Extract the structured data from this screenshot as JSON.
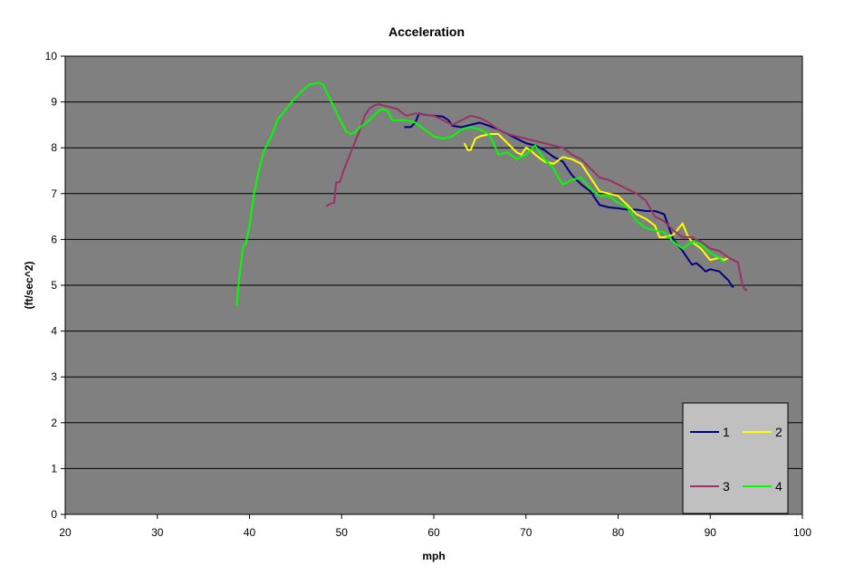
{
  "chart_data": {
    "type": "line",
    "title": "Acceleration",
    "xlabel": "mph",
    "ylabel": "(ft/sec^2)",
    "xlim": [
      20,
      100
    ],
    "ylim": [
      0,
      10
    ],
    "x_ticks": [
      "20",
      "30",
      "40",
      "50",
      "60",
      "70",
      "80",
      "90",
      "100"
    ],
    "y_ticks": [
      "0",
      "1",
      "2",
      "3",
      "4",
      "5",
      "6",
      "7",
      "8",
      "9",
      "10"
    ],
    "grid": "horizontal",
    "legend_position": "bottom-right",
    "plot_background": "#808080",
    "legend_background": "#c0c0c0",
    "series": [
      {
        "name": "1",
        "color": "#000080",
        "points": [
          [
            56.8,
            8.45
          ],
          [
            57.5,
            8.45
          ],
          [
            58.0,
            8.55
          ],
          [
            58.4,
            8.75
          ],
          [
            59,
            8.72
          ],
          [
            60,
            8.7
          ],
          [
            61,
            8.68
          ],
          [
            61.6,
            8.6
          ],
          [
            62,
            8.48
          ],
          [
            63,
            8.45
          ],
          [
            64,
            8.5
          ],
          [
            65,
            8.55
          ],
          [
            66,
            8.48
          ],
          [
            67,
            8.4
          ],
          [
            68,
            8.3
          ],
          [
            69,
            8.2
          ],
          [
            70,
            8.1
          ],
          [
            71,
            8.05
          ],
          [
            72,
            7.95
          ],
          [
            73,
            7.8
          ],
          [
            74,
            7.7
          ],
          [
            75,
            7.4
          ],
          [
            76,
            7.2
          ],
          [
            77,
            7.05
          ],
          [
            78,
            6.75
          ],
          [
            79,
            6.7
          ],
          [
            80,
            6.68
          ],
          [
            81,
            6.65
          ],
          [
            82,
            6.65
          ],
          [
            83,
            6.62
          ],
          [
            84,
            6.62
          ],
          [
            85,
            6.55
          ],
          [
            86,
            6.0
          ],
          [
            87,
            5.75
          ],
          [
            87.5,
            5.6
          ],
          [
            88,
            5.45
          ],
          [
            88.5,
            5.48
          ],
          [
            89,
            5.4
          ],
          [
            89.5,
            5.3
          ],
          [
            90,
            5.35
          ],
          [
            91,
            5.3
          ],
          [
            91.5,
            5.2
          ],
          [
            92,
            5.1
          ],
          [
            92.3,
            5.0
          ],
          [
            92.5,
            4.95
          ]
        ]
      },
      {
        "name": "2",
        "color": "#ffff00",
        "points": [
          [
            63.3,
            8.1
          ],
          [
            63.7,
            7.95
          ],
          [
            64,
            7.95
          ],
          [
            64.5,
            8.2
          ],
          [
            65,
            8.25
          ],
          [
            66,
            8.3
          ],
          [
            67,
            8.3
          ],
          [
            67.5,
            8.2
          ],
          [
            68,
            8.1
          ],
          [
            69,
            7.9
          ],
          [
            69.5,
            7.85
          ],
          [
            70,
            8.0
          ],
          [
            70.5,
            7.95
          ],
          [
            71,
            7.85
          ],
          [
            72,
            7.7
          ],
          [
            73,
            7.65
          ],
          [
            74,
            7.8
          ],
          [
            75,
            7.75
          ],
          [
            76,
            7.65
          ],
          [
            77,
            7.35
          ],
          [
            78,
            7.05
          ],
          [
            79,
            7.0
          ],
          [
            80,
            6.95
          ],
          [
            81,
            6.75
          ],
          [
            82,
            6.55
          ],
          [
            83,
            6.45
          ],
          [
            84,
            6.3
          ],
          [
            84.5,
            6.05
          ],
          [
            85,
            6.05
          ],
          [
            86,
            6.1
          ],
          [
            87,
            6.35
          ],
          [
            87.5,
            6.1
          ],
          [
            88,
            5.95
          ],
          [
            89,
            5.8
          ],
          [
            90,
            5.55
          ],
          [
            91,
            5.6
          ],
          [
            91.5,
            5.55
          ],
          [
            92,
            5.6
          ]
        ]
      },
      {
        "name": "3",
        "color": "#993366",
        "points": [
          [
            48.3,
            6.72
          ],
          [
            48.8,
            6.78
          ],
          [
            49.2,
            6.8
          ],
          [
            49.4,
            7.25
          ],
          [
            49.8,
            7.25
          ],
          [
            50.2,
            7.5
          ],
          [
            51,
            7.9
          ],
          [
            52,
            8.4
          ],
          [
            52.5,
            8.7
          ],
          [
            53,
            8.85
          ],
          [
            53.5,
            8.92
          ],
          [
            54,
            8.95
          ],
          [
            55,
            8.9
          ],
          [
            56,
            8.85
          ],
          [
            57,
            8.7
          ],
          [
            58,
            8.75
          ],
          [
            59,
            8.72
          ],
          [
            60,
            8.7
          ],
          [
            61,
            8.6
          ],
          [
            62,
            8.5
          ],
          [
            63,
            8.6
          ],
          [
            64,
            8.7
          ],
          [
            65,
            8.65
          ],
          [
            66,
            8.55
          ],
          [
            67,
            8.4
          ],
          [
            68,
            8.3
          ],
          [
            69,
            8.25
          ],
          [
            70,
            8.2
          ],
          [
            71,
            8.15
          ],
          [
            72,
            8.1
          ],
          [
            73,
            8.05
          ],
          [
            74,
            8.0
          ],
          [
            75,
            7.85
          ],
          [
            76,
            7.75
          ],
          [
            77,
            7.55
          ],
          [
            78,
            7.35
          ],
          [
            79,
            7.3
          ],
          [
            80,
            7.2
          ],
          [
            81,
            7.1
          ],
          [
            82,
            7.0
          ],
          [
            83,
            6.85
          ],
          [
            84,
            6.5
          ],
          [
            85,
            6.4
          ],
          [
            86,
            6.2
          ],
          [
            87,
            6.05
          ],
          [
            88,
            6.05
          ],
          [
            89,
            5.95
          ],
          [
            90,
            5.8
          ],
          [
            91,
            5.75
          ],
          [
            92,
            5.6
          ],
          [
            93,
            5.5
          ],
          [
            93.5,
            5.0
          ],
          [
            93.8,
            4.9
          ],
          [
            94,
            4.9
          ]
        ]
      },
      {
        "name": "4",
        "color": "#00ff00",
        "points": [
          [
            38.6,
            4.55
          ],
          [
            38.9,
            5.2
          ],
          [
            39.3,
            5.85
          ],
          [
            39.6,
            5.9
          ],
          [
            40.0,
            6.3
          ],
          [
            40.5,
            7.0
          ],
          [
            41.0,
            7.5
          ],
          [
            41.5,
            7.9
          ],
          [
            42,
            8.1
          ],
          [
            42.5,
            8.3
          ],
          [
            43,
            8.6
          ],
          [
            44,
            8.85
          ],
          [
            45,
            9.1
          ],
          [
            46,
            9.3
          ],
          [
            46.5,
            9.38
          ],
          [
            47,
            9.4
          ],
          [
            47.5,
            9.42
          ],
          [
            48,
            9.38
          ],
          [
            48.5,
            9.15
          ],
          [
            49,
            8.95
          ],
          [
            49.5,
            8.75
          ],
          [
            50,
            8.55
          ],
          [
            50.5,
            8.35
          ],
          [
            51,
            8.3
          ],
          [
            51.5,
            8.35
          ],
          [
            52,
            8.45
          ],
          [
            53,
            8.6
          ],
          [
            54,
            8.8
          ],
          [
            54.5,
            8.85
          ],
          [
            55,
            8.8
          ],
          [
            55.5,
            8.6
          ],
          [
            56,
            8.6
          ],
          [
            57,
            8.6
          ],
          [
            58,
            8.55
          ],
          [
            59,
            8.4
          ],
          [
            60,
            8.25
          ],
          [
            61,
            8.2
          ],
          [
            62,
            8.25
          ],
          [
            63,
            8.4
          ],
          [
            64,
            8.45
          ],
          [
            65,
            8.4
          ],
          [
            66,
            8.3
          ],
          [
            66.5,
            8.1
          ],
          [
            67,
            7.85
          ],
          [
            68,
            7.9
          ],
          [
            69,
            7.75
          ],
          [
            70,
            7.85
          ],
          [
            71,
            8.05
          ],
          [
            72,
            7.75
          ],
          [
            73,
            7.55
          ],
          [
            73.5,
            7.35
          ],
          [
            74,
            7.2
          ],
          [
            75,
            7.3
          ],
          [
            76,
            7.35
          ],
          [
            77,
            7.1
          ],
          [
            78,
            6.95
          ],
          [
            79,
            6.95
          ],
          [
            80,
            6.8
          ],
          [
            81,
            6.7
          ],
          [
            82,
            6.4
          ],
          [
            83,
            6.25
          ],
          [
            84,
            6.2
          ],
          [
            85,
            6.15
          ],
          [
            86,
            5.95
          ],
          [
            87,
            5.8
          ],
          [
            88,
            5.95
          ],
          [
            89,
            5.9
          ],
          [
            90,
            5.7
          ],
          [
            91,
            5.6
          ],
          [
            91.5,
            5.5
          ]
        ]
      }
    ]
  }
}
